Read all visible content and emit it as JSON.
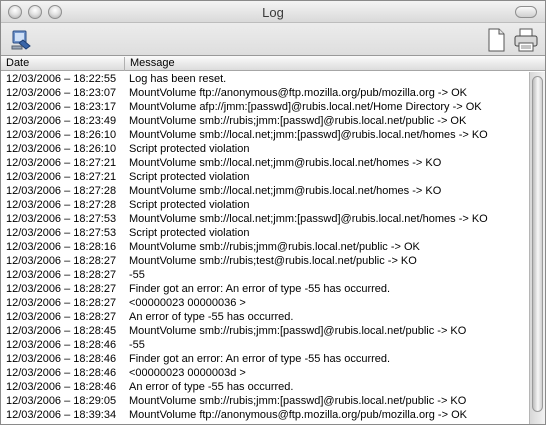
{
  "window": {
    "title": "Log"
  },
  "toolbar": {
    "left_icon": "computer-finder-icon",
    "doc_icon": "document-icon",
    "print_icon": "printer-icon"
  },
  "table": {
    "columns": [
      "Date",
      "Message"
    ],
    "rows": [
      [
        "12/03/2006 – 18:22:55",
        "Log has been reset."
      ],
      [
        "12/03/2006 – 18:23:07",
        "MountVolume ftp://anonymous@ftp.mozilla.org/pub/mozilla.org -> OK"
      ],
      [
        "12/03/2006 – 18:23:17",
        "MountVolume afp://jmm:[passwd]@rubis.local.net/Home Directory -> OK"
      ],
      [
        "12/03/2006 – 18:23:49",
        "MountVolume smb://rubis;jmm:[passwd]@rubis.local.net/public -> OK"
      ],
      [
        "12/03/2006 – 18:26:10",
        "MountVolume smb://local.net;jmm:[passwd]@rubis.local.net/homes -> KO"
      ],
      [
        "12/03/2006 – 18:26:10",
        "Script protected violation"
      ],
      [
        "12/03/2006 – 18:27:21",
        "MountVolume smb://local.net;jmm@rubis.local.net/homes -> KO"
      ],
      [
        "12/03/2006 – 18:27:21",
        "Script protected violation"
      ],
      [
        "12/03/2006 – 18:27:28",
        "MountVolume smb://local.net;jmm@rubis.local.net/homes -> KO"
      ],
      [
        "12/03/2006 – 18:27:28",
        "Script protected violation"
      ],
      [
        "12/03/2006 – 18:27:53",
        "MountVolume smb://local.net;jmm:[passwd]@rubis.local.net/homes -> KO"
      ],
      [
        "12/03/2006 – 18:27:53",
        "Script protected violation"
      ],
      [
        "12/03/2006 – 18:28:16",
        "MountVolume smb://rubis;jmm@rubis.local.net/public -> OK"
      ],
      [
        "12/03/2006 – 18:28:27",
        "MountVolume smb://rubis;test@rubis.local.net/public -> KO"
      ],
      [
        "12/03/2006 – 18:28:27",
        "-55"
      ],
      [
        "12/03/2006 – 18:28:27",
        "Finder got an error: An error of type -55 has occurred."
      ],
      [
        "12/03/2006 – 18:28:27",
        "<00000023 00000036 >"
      ],
      [
        "12/03/2006 – 18:28:27",
        "An error of type -55 has occurred."
      ],
      [
        "12/03/2006 – 18:28:45",
        "MountVolume smb://rubis;jmm:[passwd]@rubis.local.net/public -> KO"
      ],
      [
        "12/03/2006 – 18:28:46",
        "-55"
      ],
      [
        "12/03/2006 – 18:28:46",
        "Finder got an error: An error of type -55 has occurred."
      ],
      [
        "12/03/2006 – 18:28:46",
        "<00000023 0000003d >"
      ],
      [
        "12/03/2006 – 18:28:46",
        "An error of type -55 has occurred."
      ],
      [
        "12/03/2006 – 18:29:05",
        "MountVolume smb://rubis;jmm:[passwd]@rubis.local.net/public -> KO"
      ],
      [
        "12/03/2006 – 18:39:34",
        "MountVolume ftp://anonymous@ftp.mozilla.org/pub/mozilla.org -> OK"
      ]
    ]
  }
}
